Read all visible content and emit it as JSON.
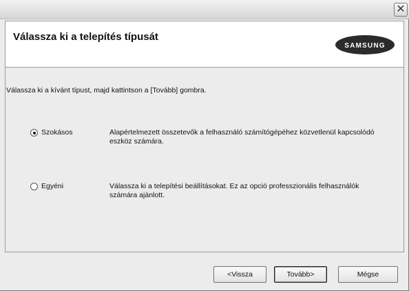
{
  "window": {
    "close_glyph": "✕"
  },
  "header": {
    "title": "Válassza ki a telepítés típusát",
    "logo_text": "SAMSUNG"
  },
  "main": {
    "instruction": "Válassza ki a kívánt típust, majd kattintson a [Tovább] gombra.",
    "options": [
      {
        "label": "Szokásos",
        "checked": true,
        "description": "Alapértelmezett összetevők a felhasználó számítógépéhez közvetlenül kapcsolódó eszköz számára."
      },
      {
        "label": "Egyéni",
        "checked": false,
        "description": "Válassza ki a telepítési beállításokat. Ez az opció professzionális felhasználók számára ajánlott."
      }
    ]
  },
  "buttons": {
    "back": "<Vissza",
    "next": "Tovább>",
    "cancel": "Mégse"
  },
  "colors": {
    "dialog_bg": "#ececec",
    "header_bg": "#ffffff"
  },
  "icons": {
    "close": "close-icon",
    "logo": "samsung-logo"
  }
}
